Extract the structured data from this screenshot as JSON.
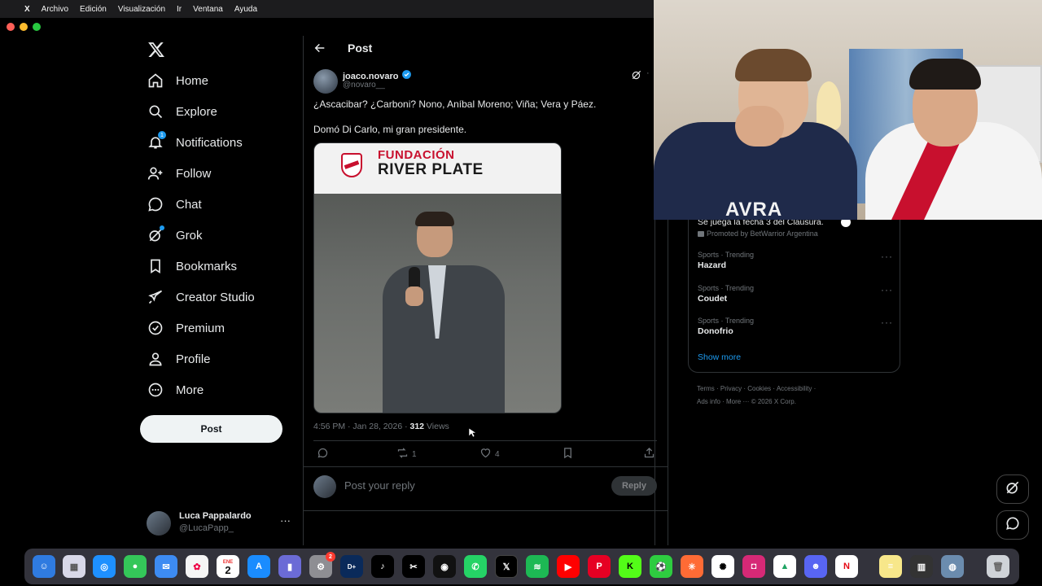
{
  "menubar": {
    "app": "X",
    "items": [
      "Archivo",
      "Edición",
      "Visualización",
      "Ir",
      "Ventana",
      "Ayuda"
    ]
  },
  "nav": {
    "items": [
      {
        "label": "Home",
        "icon": "home-icon"
      },
      {
        "label": "Explore",
        "icon": "search-icon"
      },
      {
        "label": "Notifications",
        "icon": "bell-icon",
        "badge": "1"
      },
      {
        "label": "Follow",
        "icon": "add-person-icon"
      },
      {
        "label": "Chat",
        "icon": "chat-bubble-icon"
      },
      {
        "label": "Grok",
        "icon": "grok-icon"
      },
      {
        "label": "Bookmarks",
        "icon": "bookmark-icon"
      },
      {
        "label": "Creator Studio",
        "icon": "rocket-icon"
      },
      {
        "label": "Premium",
        "icon": "verified-badge-icon"
      },
      {
        "label": "Profile",
        "icon": "person-icon"
      },
      {
        "label": "More",
        "icon": "more-circle-icon"
      }
    ],
    "post_button": "Post"
  },
  "account": {
    "name": "Luca Pappalardo",
    "handle": "@LucaPapp_"
  },
  "header": {
    "title": "Post"
  },
  "post": {
    "author_name": "joaco.novaro",
    "author_handle": "@novaro__",
    "line1": "¿Ascacibar? ¿Carboni? Nono, Aníbal Moreno; Viña; Vera y Páez.",
    "line2": "Domó Di Carlo, mi gran presidente.",
    "image_banner_line1": "FUNDACIÓN",
    "image_banner_line2": "RIVER PLATE",
    "timestamp": "4:56 PM · Jan 28, 2026 ·",
    "views_count": "312",
    "views_label": "Views",
    "retweets": "1",
    "likes": "4"
  },
  "reply": {
    "placeholder": "Post your reply",
    "button": "Reply"
  },
  "trends": {
    "promo_text": "Se juega la fecha 3 del Clausura.",
    "promo_by": "Promoted by BetWarrior Argentina",
    "items": [
      {
        "meta": "Sports · Trending",
        "name": "Hazard"
      },
      {
        "meta": "Sports · Trending",
        "name": "Coudet"
      },
      {
        "meta": "Sports · Trending",
        "name": "Donofrio"
      }
    ],
    "show_more": "Show more"
  },
  "footer": {
    "links": [
      "Terms",
      "Privacy",
      "Cookies",
      "Accessibility",
      "Ads info",
      "More ···"
    ],
    "copyright": "© 2026 X Corp."
  },
  "webcam": {
    "jersey_text": "AVRA"
  },
  "dock": {
    "calendar_month": "ENE",
    "calendar_day": "2",
    "notification_badge": "2"
  },
  "colors": {
    "accent": "#1d9bf0",
    "background": "#000000",
    "border": "#2f3336",
    "muted": "#71767b"
  }
}
